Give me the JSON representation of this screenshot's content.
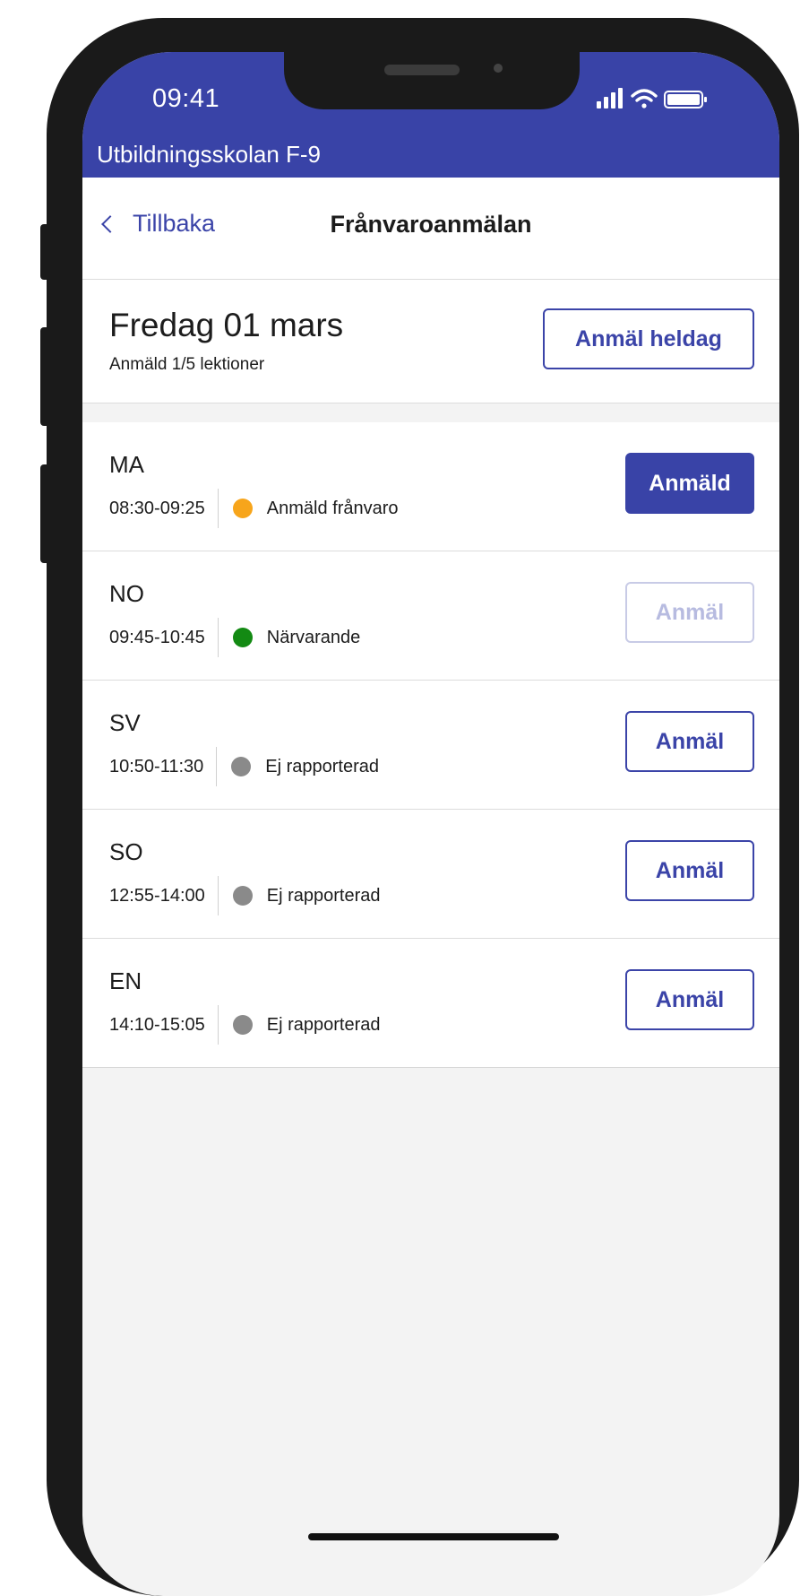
{
  "status_bar": {
    "time": "09:41"
  },
  "app": {
    "title": "Utbildningsskolan F-9",
    "accent_color": "#3943a7"
  },
  "nav": {
    "back_label": "Tillbaka",
    "title": "Frånvaroanmälan"
  },
  "day": {
    "title": "Fredag 01 mars",
    "subtitle": "Anmäld 1/5 lektioner",
    "full_day_button": "Anmäl heldag"
  },
  "lessons": [
    {
      "subject": "MA",
      "time": "08:30-09:25",
      "status": "Anmäld frånvaro",
      "status_color": "#f7a51b",
      "button_label": "Anmäld",
      "button_state": "filled"
    },
    {
      "subject": "NO",
      "time": "09:45-10:45",
      "status": "Närvarande",
      "status_color": "#138a13",
      "button_label": "Anmäl",
      "button_state": "disabled"
    },
    {
      "subject": "SV",
      "time": "10:50-11:30",
      "status": "Ej rapporterad",
      "status_color": "#8a8a8a",
      "button_label": "Anmäl",
      "button_state": "outline"
    },
    {
      "subject": "SO",
      "time": "12:55-14:00",
      "status": "Ej rapporterad",
      "status_color": "#8a8a8a",
      "button_label": "Anmäl",
      "button_state": "outline"
    },
    {
      "subject": "EN",
      "time": "14:10-15:05",
      "status": "Ej rapporterad",
      "status_color": "#8a8a8a",
      "button_label": "Anmäl",
      "button_state": "outline"
    }
  ]
}
